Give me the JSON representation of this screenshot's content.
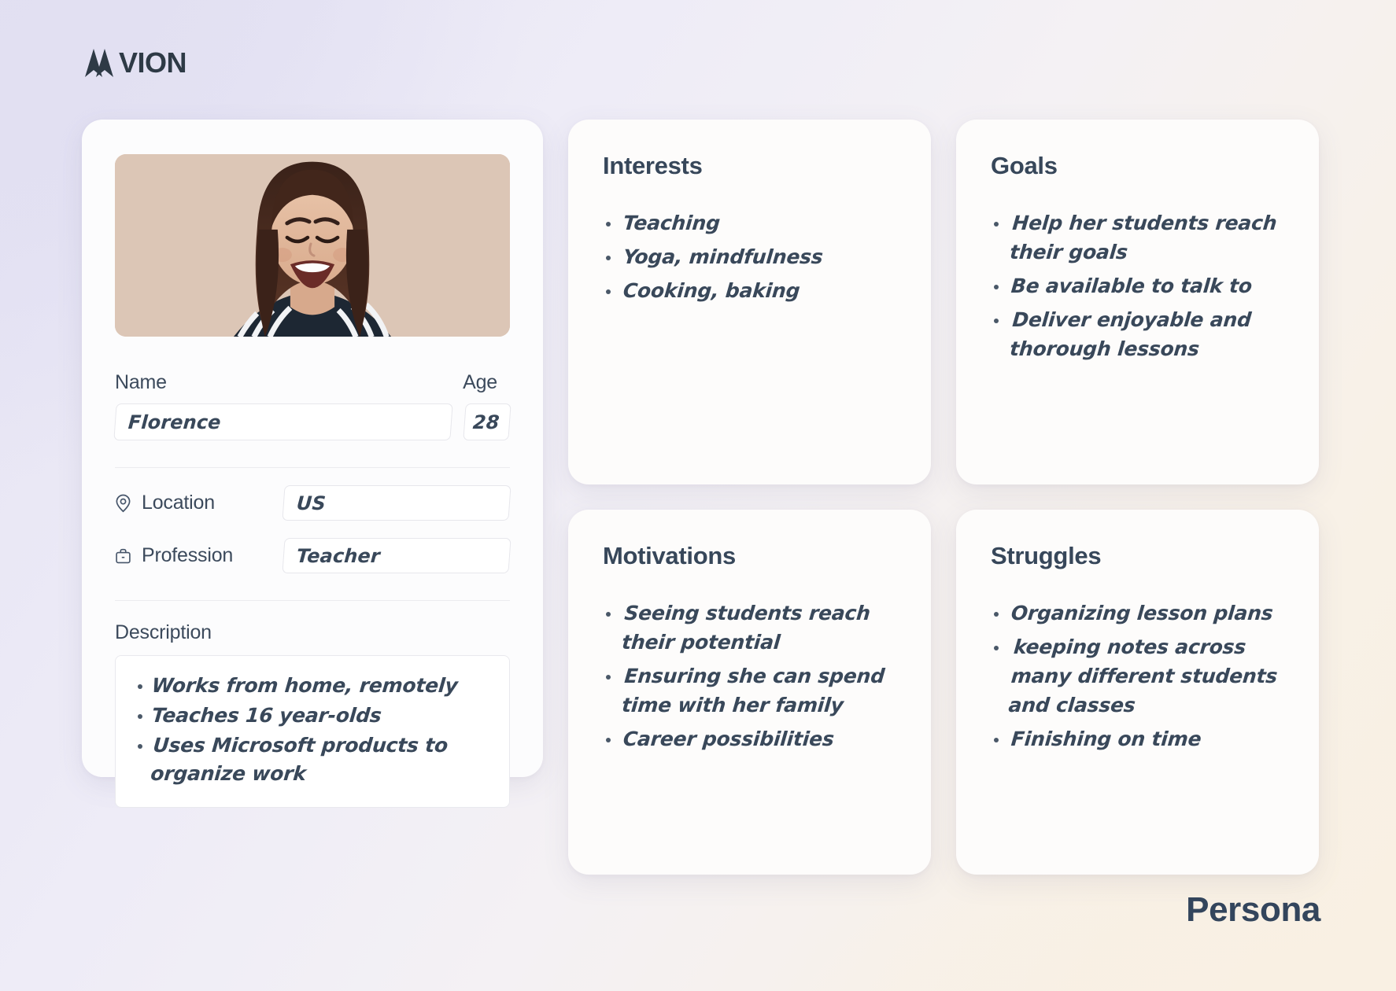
{
  "brand": {
    "logo_text": "VION",
    "logo_full": "AVION",
    "logo_icon": "avion-chevron-mark"
  },
  "footer": {
    "label": "Persona"
  },
  "profile": {
    "photo_alt": "laughing-woman-portrait",
    "name_label": "Name",
    "name_value": "Florence",
    "age_label": "Age",
    "age_value": "28",
    "location_label": "Location",
    "location_icon": "map-pin-icon",
    "location_value": "US",
    "profession_label": "Profession",
    "profession_icon": "briefcase-icon",
    "profession_value": "Teacher",
    "description_label": "Description",
    "description_items": [
      "Works from home, remotely",
      "Teaches 16 year-olds",
      "Uses Microsoft products to organize work"
    ]
  },
  "cards": {
    "interests": {
      "title": "Interests",
      "items": [
        "Teaching",
        "Yoga, mindfulness",
        "Cooking, baking"
      ]
    },
    "goals": {
      "title": "Goals",
      "items": [
        "Help her students reach their goals",
        "Be available to talk to",
        "Deliver enjoyable and thorough lessons"
      ]
    },
    "motivations": {
      "title": "Motivations",
      "items": [
        "Seeing students reach their potential",
        "Ensuring she can spend time with her family",
        "Career possibilities"
      ]
    },
    "struggles": {
      "title": "Struggles",
      "items": [
        "Organizing lesson plans",
        "keeping notes across many different students and classes",
        "Finishing on time"
      ]
    }
  },
  "colors": {
    "text_dark": "#37475a",
    "handwriting": "#39485a",
    "photo_bg": "#dcc6b6",
    "card_bg": "#fdfdfd",
    "bg_lavender": "#e5e3f3",
    "bg_cream": "#f9f0e2"
  }
}
